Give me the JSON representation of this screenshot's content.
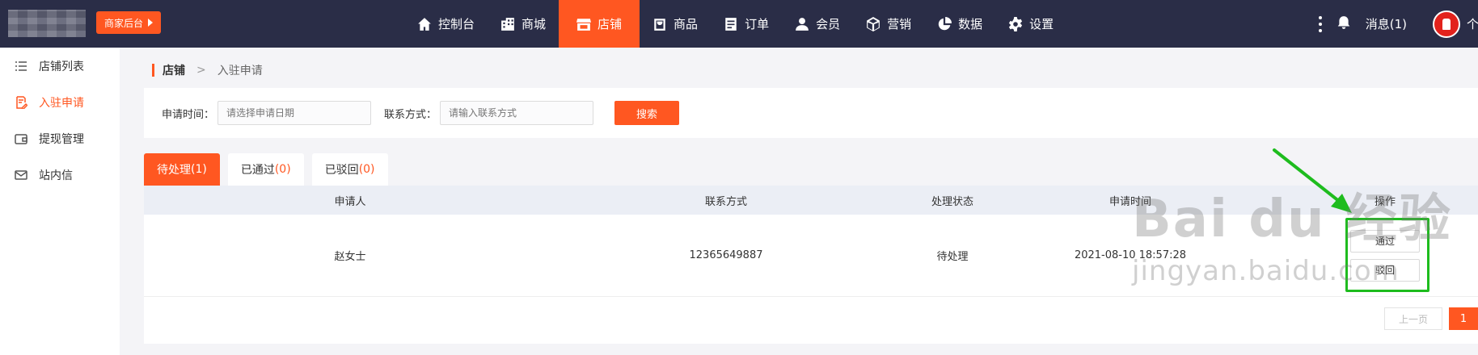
{
  "topbar": {
    "merchant_button": "商家后台",
    "nav": [
      {
        "label": "控制台",
        "icon": "home-icon"
      },
      {
        "label": "商城",
        "icon": "building-icon"
      },
      {
        "label": "店铺",
        "icon": "shop-icon",
        "active": true
      },
      {
        "label": "商品",
        "icon": "bag-icon"
      },
      {
        "label": "订单",
        "icon": "order-icon"
      },
      {
        "label": "会员",
        "icon": "user-icon"
      },
      {
        "label": "营销",
        "icon": "cube-icon"
      },
      {
        "label": "数据",
        "icon": "pie-chart-icon"
      },
      {
        "label": "设置",
        "icon": "gear-icon"
      }
    ],
    "messages": "消息(1)",
    "user_label": "个"
  },
  "sidebar": {
    "items": [
      {
        "label": "店铺列表",
        "icon": "list-icon"
      },
      {
        "label": "入驻申请",
        "icon": "application-icon",
        "active": true
      },
      {
        "label": "提现管理",
        "icon": "wallet-icon"
      },
      {
        "label": "站内信",
        "icon": "mail-icon"
      }
    ]
  },
  "breadcrumb": {
    "home": "店铺",
    "separator": ">",
    "current": "入驻申请"
  },
  "filter": {
    "date_label": "申请时间：",
    "date_placeholder": "请选择申请日期",
    "contact_label": "联系方式：",
    "contact_placeholder": "请输入联系方式",
    "search_button": "搜索"
  },
  "tabs": [
    {
      "label": "待处理",
      "count": "(1)",
      "active": true
    },
    {
      "label": "已通过",
      "count": "(0)"
    },
    {
      "label": "已驳回",
      "count": "(0)"
    }
  ],
  "table": {
    "headers": [
      "申请人",
      "联系方式",
      "处理状态",
      "申请时间",
      "操作"
    ],
    "rows": [
      {
        "applicant": "赵女士",
        "contact": "12365649887",
        "status": "待处理",
        "time": "2021-08-10 18:57:28"
      }
    ],
    "actions": {
      "approve": "通过",
      "reject": "驳回"
    }
  },
  "pagination": {
    "prev": "上一页",
    "current_page": "1"
  },
  "watermark": {
    "main": "Bai du 经验",
    "url": "jingyan.baidu.com"
  },
  "colors": {
    "accent": "#ff5721",
    "topbar": "#2a2d47",
    "highlight": "#1ebc1e"
  }
}
